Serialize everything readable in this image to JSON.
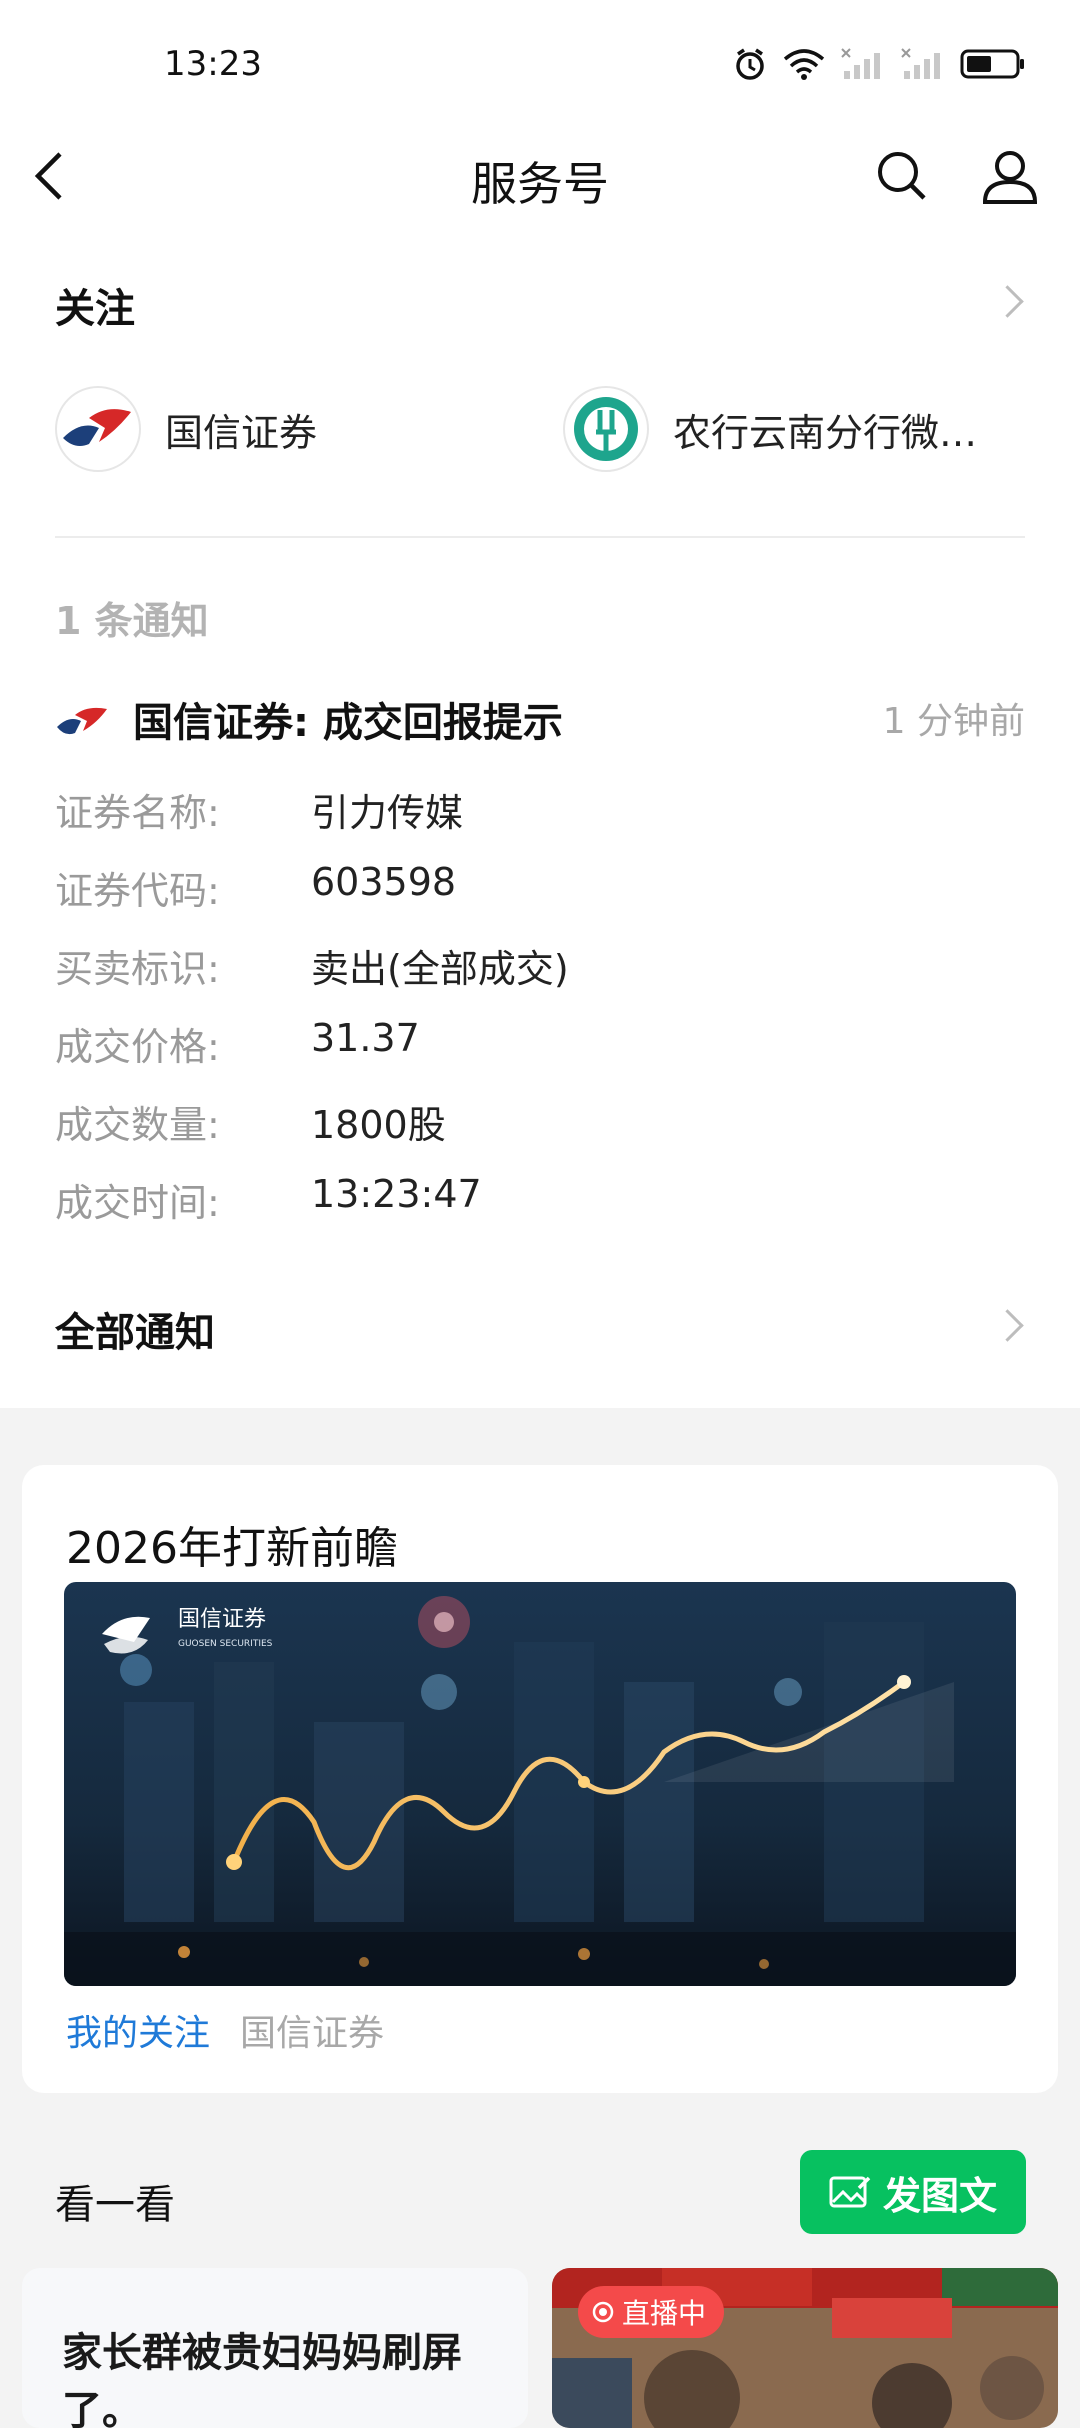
{
  "status_bar": {
    "time": "13:23"
  },
  "nav": {
    "title": "服务号"
  },
  "follow": {
    "heading": "关注",
    "accounts": [
      {
        "name": "国信证券",
        "icon": "guosen-logo-icon"
      },
      {
        "name": "农行云南分行微…",
        "icon": "abc-bank-logo-icon"
      }
    ]
  },
  "notice": {
    "count_label": "1 条通知",
    "sender_title": "国信证券: 成交回报提示",
    "time_ago": "1 分钟前",
    "rows": [
      {
        "label": "证券名称:",
        "value": "引力传媒"
      },
      {
        "label": "证券代码:",
        "value": "603598"
      },
      {
        "label": "买卖标识:",
        "value": "卖出(全部成交)"
      },
      {
        "label": "成交价格:",
        "value": "31.37"
      },
      {
        "label": "成交数量:",
        "value": "1800股"
      },
      {
        "label": "成交时间:",
        "value": "13:23:47"
      }
    ],
    "all_label": "全部通知"
  },
  "article": {
    "title": "2026年打新前瞻",
    "banner_brand": "国信证券",
    "banner_brand_en": "GUOSEN SECURITIES",
    "tag_primary": "我的关注",
    "tag_secondary": "国信证券"
  },
  "discover": {
    "heading": "看一看",
    "post_button": "发图文",
    "card1_text": "家长群被贵妇妈妈刷屏了。",
    "card2_live": "直播中"
  },
  "colors": {
    "accent_green": "#07c160",
    "link_blue": "#1f7ad8",
    "live_red": "#f44a4a"
  }
}
